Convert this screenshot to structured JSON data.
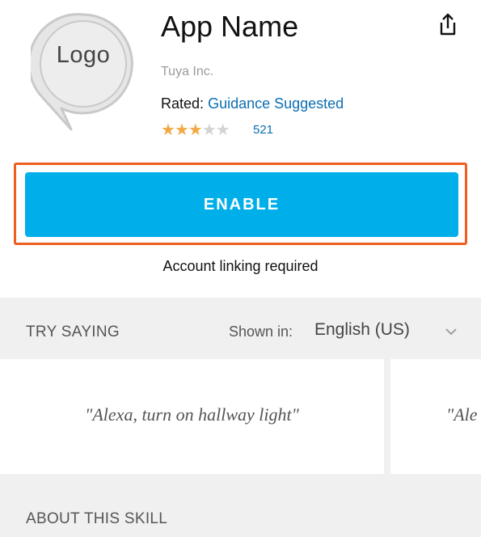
{
  "app": {
    "logo_text": "Logo",
    "name": "App Name",
    "developer": "Tuya Inc.",
    "rated_label": "Rated:",
    "rated_value": "Guidance Suggested",
    "rating": {
      "stars_filled": 3,
      "stars_total": 5,
      "count": "521"
    }
  },
  "icons": {
    "share": "share-icon",
    "chevron": "chevron-down-icon"
  },
  "enable": {
    "label": "ENABLE"
  },
  "linking_note": "Account linking required",
  "try_saying": {
    "title": "TRY SAYING",
    "shown_in_label": "Shown in:",
    "language": "English (US)",
    "utterances": [
      "\"Alexa, turn on hallway light\"",
      "\"Ale"
    ]
  },
  "about": {
    "title": "ABOUT THIS SKILL"
  },
  "colors": {
    "accent": "#00aeea",
    "highlight": "#ee5e21",
    "link": "#0a6eb2",
    "star": "#f3a847",
    "section_bg": "#f0f0f0"
  }
}
